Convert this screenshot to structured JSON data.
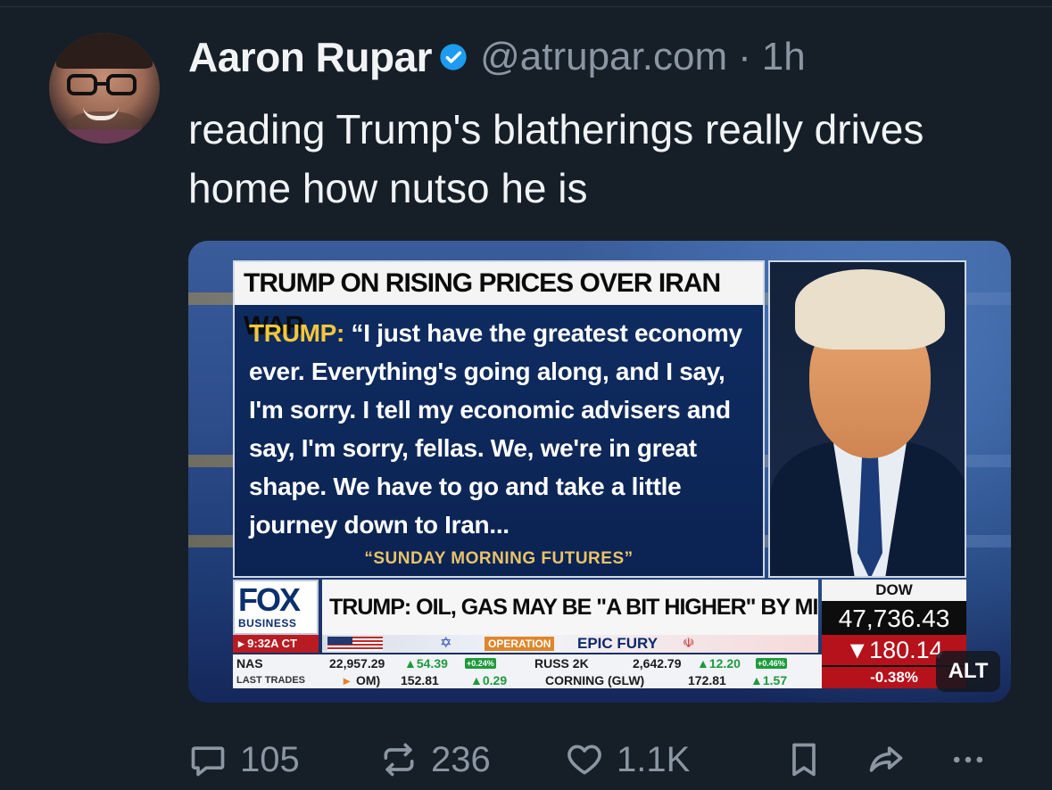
{
  "post": {
    "author_name": "Aaron Rupar",
    "handle": "@atrupar.com",
    "separator": "·",
    "time": "1h",
    "text": "reading Trump's blatherings really drives home how nutso he is"
  },
  "media": {
    "quote_title": "TRUMP ON RISING PRICES OVER IRAN WAR",
    "quote_speaker": "TRUMP:",
    "quote_text": " “I just have the greatest economy ever. Everything's going along, and I say, I'm sorry. I tell my economic advisers and say, I'm sorry, fellas. We, we're in great shape. We have to go and take a little journey down to Iran...",
    "quote_source": "“SUNDAY MORNING FUTURES”",
    "network_logo": "FOX",
    "network_sub": "BUSINESS",
    "clock": "▸ 9:32A CT",
    "headline": "TRUMP: OIL, GAS MAY BE \"A BIT HIGHER\" BY MIDTERMS",
    "banner_operation": "OPERATION",
    "banner_name": "EPIC FURY",
    "ticker_row1": {
      "nas": "NAS",
      "nas_value": "22,957.29",
      "nas_change": "▲54.39",
      "nas_pct": "+0.24%",
      "russ": "RUSS 2K",
      "russ_value": "2,642.79",
      "russ_change": "▲12.20",
      "russ_pct": "+0.46%"
    },
    "ticker_row2": {
      "last_trades": "LAST TRADES",
      "arrow": "▸",
      "item1": "OM)",
      "item1_value": "152.81",
      "item1_change": "▲0.29",
      "item2": "CORNING (GLW)",
      "item2_value": "172.81",
      "item2_change": "▲1.57"
    },
    "dow_label": "DOW",
    "dow_value": "47,736.43",
    "dow_change": "▼180.14",
    "dow_pct": "-0.38%",
    "alt_badge": "ALT"
  },
  "actions": {
    "replies": "105",
    "reposts": "236",
    "likes": "1.1K"
  },
  "icons": {
    "verified": "verified-badge-icon",
    "reply": "reply-icon",
    "repost": "repost-icon",
    "like": "heart-icon",
    "bookmark": "bookmark-icon",
    "share": "share-icon",
    "more": "more-icon"
  },
  "colors": {
    "background": "#161e27",
    "text": "#f1f3f5",
    "muted": "#8a96a3",
    "verified": "#1d9bf0"
  }
}
